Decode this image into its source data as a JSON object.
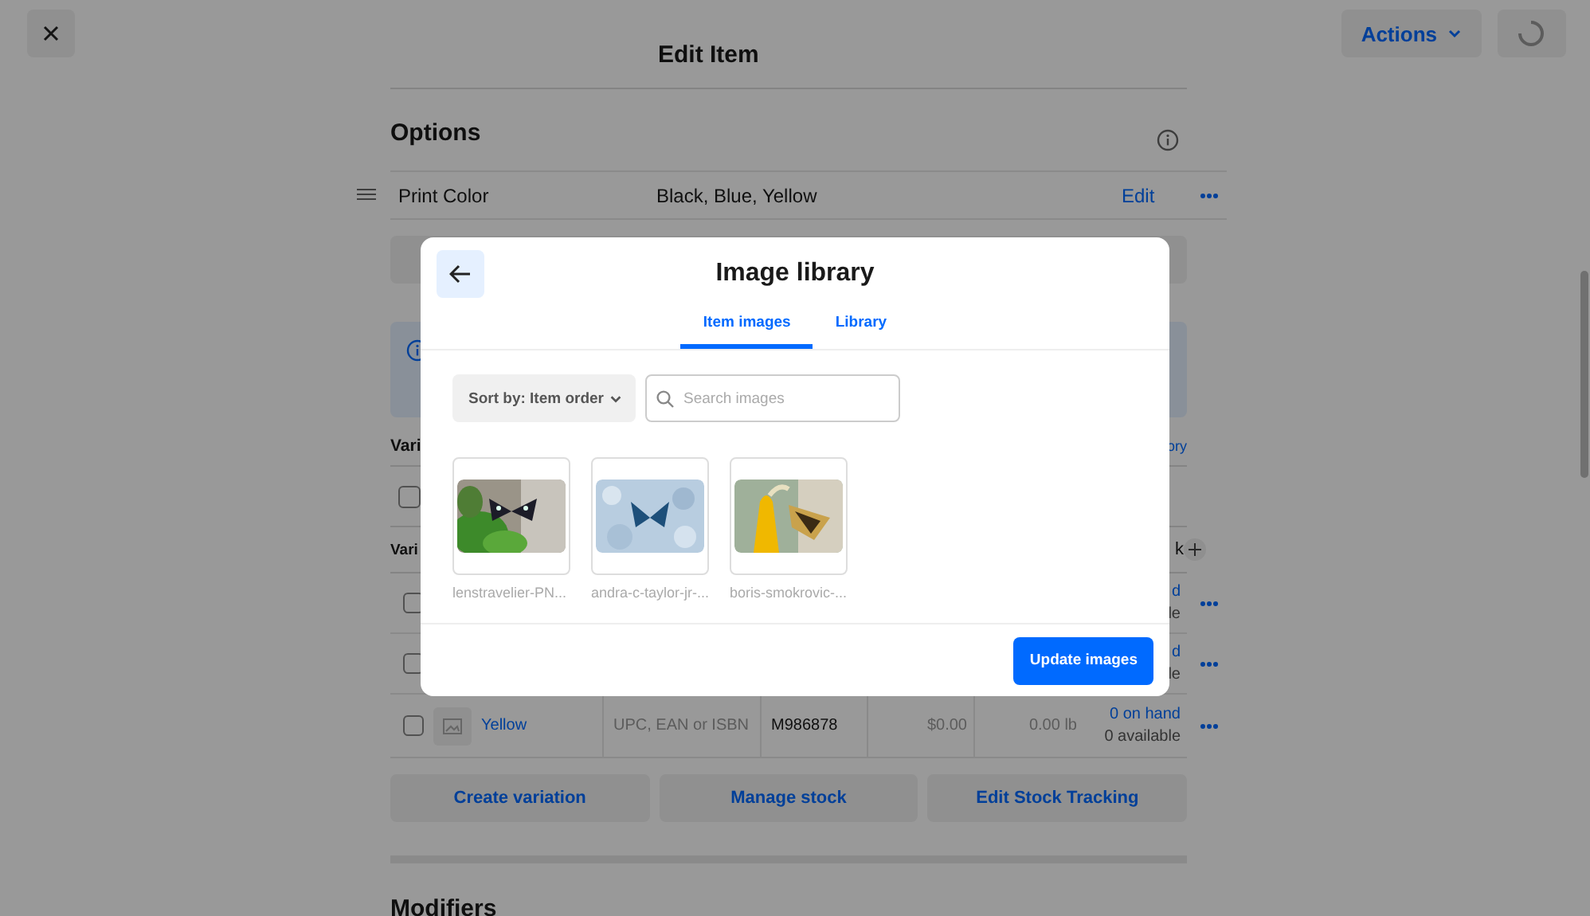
{
  "top_bar": {
    "title": "Edit Item",
    "actions_button": "Actions"
  },
  "options": {
    "heading": "Options",
    "rows": [
      {
        "name": "Print Color",
        "values": "Black, Blue, Yellow",
        "edit_link": "Edit"
      }
    ]
  },
  "variations": {
    "heading": "Vari",
    "link": "ory",
    "select_all_checked": false,
    "header": {
      "column_1": "Vari",
      "stock": "k"
    },
    "rows": [
      {
        "kind": "partial",
        "checked": false,
        "stock_on_hand": "d",
        "stock_available": "le"
      },
      {
        "kind": "partial",
        "checked": false,
        "stock_on_hand": "d",
        "stock_available": "le"
      },
      {
        "kind": "full",
        "checked": false,
        "name": "Yellow",
        "gtin_placeholder": "UPC, EAN or ISBN",
        "sku": "M986878",
        "price": "$0.00",
        "weight": "0.00 lb",
        "stock_on_hand": "0 on hand",
        "stock_available": "0 available"
      }
    ],
    "buttons": [
      "Create variation",
      "Manage stock",
      "Edit Stock Tracking"
    ]
  },
  "modifiers": {
    "heading": "Modifiers"
  },
  "image_library": {
    "title": "Image library",
    "tabs": [
      {
        "label": "Item images",
        "selected": true
      },
      {
        "label": "Library",
        "selected": false
      }
    ],
    "sort_button": "Sort by: Item order",
    "search": {
      "placeholder": "Search images"
    },
    "images": [
      {
        "kind": "picture",
        "caption": "lenstravelier-PN..."
      },
      {
        "kind": "picture",
        "caption": "andra-c-taylor-jr-..."
      },
      {
        "kind": "picture",
        "caption": "boris-smokrovic-..."
      }
    ],
    "update_button": "Update images"
  }
}
